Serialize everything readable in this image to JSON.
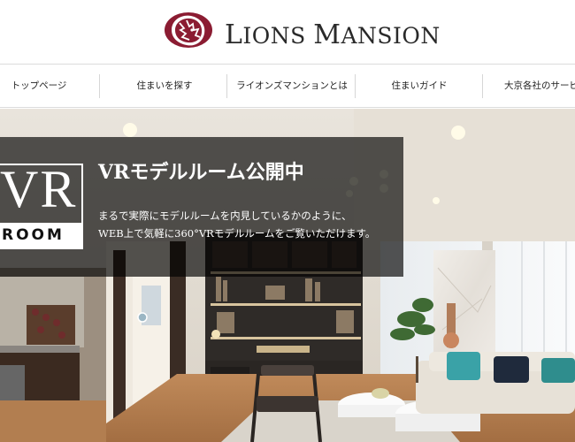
{
  "brand": {
    "name_first": "L",
    "name_rest1": "IONS ",
    "name_second": "M",
    "name_rest2": "ANSION",
    "logo_icon": "lion-head-icon",
    "brand_color": "#8b1c32"
  },
  "nav": {
    "items": [
      {
        "label": "トップページ"
      },
      {
        "label": "住まいを探す"
      },
      {
        "label": "ライオンズマンションとは"
      },
      {
        "label": "住まいガイド"
      },
      {
        "label": "大京各社のサービス"
      }
    ]
  },
  "hero": {
    "badge_big": "VR",
    "badge_small": "ROOM",
    "title": "VRモデルルーム公開中",
    "description_line1": "まるで実際にモデルルームを内見しているかのように、",
    "description_line2": "WEB上で気軽に360°VRモデルルームをご覧いただけます。"
  }
}
